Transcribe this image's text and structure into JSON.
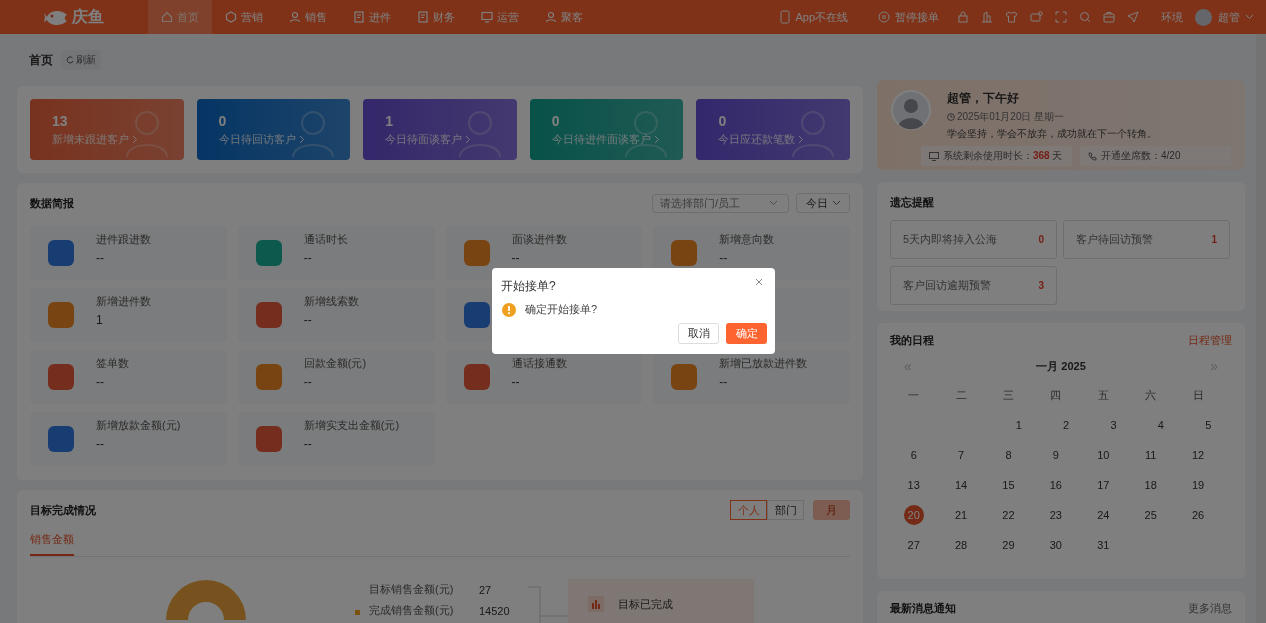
{
  "nav": {
    "logo": "庆鱼",
    "items": [
      {
        "label": "首页",
        "selected": true
      },
      {
        "label": "营销",
        "selected": false
      },
      {
        "label": "销售",
        "selected": false
      },
      {
        "label": "进件",
        "selected": false
      },
      {
        "label": "财务",
        "selected": false
      },
      {
        "label": "运营",
        "selected": false
      },
      {
        "label": "聚客",
        "selected": false
      }
    ],
    "app_status": "App不在线",
    "pause": "暂停接单",
    "env": "环境",
    "user": "超管"
  },
  "header": {
    "title": "首页",
    "refresh": "刷新"
  },
  "stat_cards": [
    {
      "value": "13",
      "label": "新增未跟进客户"
    },
    {
      "value": "0",
      "label": "今日待回访客户"
    },
    {
      "value": "1",
      "label": "今日待面谈客户"
    },
    {
      "value": "0",
      "label": "今日待进件面谈客户"
    },
    {
      "value": "0",
      "label": "今日应还款笔数"
    }
  ],
  "data_brief": {
    "title": "数据简报",
    "select": {
      "placeholder": "请选择部门/员工"
    },
    "period": "今日",
    "metrics": [
      {
        "kind": "shown",
        "label": "进件跟进数",
        "value": "--"
      },
      {
        "kind": "shown",
        "label": "通话时长",
        "value": "--"
      },
      {
        "kind": "shown",
        "label": "面谈进件数",
        "value": "--"
      },
      {
        "kind": "shown",
        "label": "新增意向数",
        "value": "--"
      },
      {
        "kind": "shown",
        "label": "新增进件数",
        "value": "1"
      },
      {
        "kind": "shown",
        "label": "新增线索数",
        "value": "--"
      },
      {
        "kind": "icon_only"
      },
      {
        "kind": "covered"
      },
      {
        "kind": "shown",
        "label": "签单数",
        "value": "--"
      },
      {
        "kind": "shown",
        "label": "回款金额(元)",
        "value": "--"
      },
      {
        "kind": "shown",
        "label": "通话接通数",
        "value": "--"
      },
      {
        "kind": "shown",
        "label": "新增已放款进件数",
        "value": "--"
      },
      {
        "kind": "shown",
        "label": "新增放款金额(元)",
        "value": "--"
      },
      {
        "kind": "shown",
        "label": "新增实支出金额(元)",
        "value": "--"
      }
    ]
  },
  "goals": {
    "title": "目标完成情况",
    "scopes": [
      {
        "label": "个人",
        "selected": true
      },
      {
        "label": "部门",
        "selected": false
      }
    ],
    "period": "月",
    "tab": "销售金额",
    "legend": [
      {
        "label": "目标销售金额(元)",
        "value": "27",
        "marker": false
      },
      {
        "label": "完成销售金额(元)",
        "value": "14520",
        "marker": true
      }
    ],
    "callout": "目标已完成"
  },
  "greeting": {
    "title": "超管，下午好",
    "date": "2025年01月20日 星期一",
    "motto": "学会坚持，学会不放弃，成功就在下一个转角。",
    "remaining": "系统剩余使用时长：**368** 天",
    "seats": "开通坐席数：4/20"
  },
  "memo": {
    "title": "遗忘提醒",
    "items": [
      {
        "label": "5天内即将掉入公海",
        "count": "0"
      },
      {
        "label": "客户待回访预警",
        "count": "1"
      },
      {
        "label": "客户回访逾期预警",
        "count": "3"
      }
    ]
  },
  "schedule": {
    "title": "我的日程",
    "manage": "日程管理",
    "prev": "«",
    "next": "»",
    "month": "一月 2025",
    "weekdays": [
      "一",
      "二",
      "三",
      "四",
      "五",
      "六",
      "日"
    ],
    "weeks": [
      {
        "days": [
          {
            "day": "1",
            "selected": false
          },
          {
            "day": "2",
            "selected": false
          },
          {
            "day": "3",
            "selected": false
          },
          {
            "day": "4",
            "selected": false
          },
          {
            "day": "5",
            "selected": false
          }
        ]
      },
      {
        "days": [
          {
            "day": "6",
            "selected": false
          },
          {
            "day": "7",
            "selected": false
          },
          {
            "day": "8",
            "selected": false
          },
          {
            "day": "9",
            "selected": false
          },
          {
            "day": "10",
            "selected": false
          },
          {
            "day": "11",
            "selected": false
          },
          {
            "day": "12",
            "selected": false
          }
        ]
      },
      {
        "days": [
          {
            "day": "13",
            "selected": false
          },
          {
            "day": "14",
            "selected": false
          },
          {
            "day": "15",
            "selected": false
          },
          {
            "day": "16",
            "selected": false
          },
          {
            "day": "17",
            "selected": false
          },
          {
            "day": "18",
            "selected": false
          },
          {
            "day": "19",
            "selected": false
          }
        ]
      },
      {
        "days": [
          {
            "day": "20",
            "selected": true
          },
          {
            "day": "21",
            "selected": false
          },
          {
            "day": "22",
            "selected": false
          },
          {
            "day": "23",
            "selected": false
          },
          {
            "day": "24",
            "selected": false
          },
          {
            "day": "25",
            "selected": false
          },
          {
            "day": "26",
            "selected": false
          }
        ]
      },
      {
        "days": [
          {
            "day": "27",
            "selected": false
          },
          {
            "day": "28",
            "selected": false
          },
          {
            "day": "29",
            "selected": false
          },
          {
            "day": "30",
            "selected": false
          },
          {
            "day": "31",
            "selected": false
          }
        ]
      }
    ]
  },
  "news": {
    "title": "最新消息通知",
    "more": "更多消息"
  },
  "modal": {
    "title": "开始接单?",
    "message": "确定开始接单?",
    "cancel": "取消",
    "confirm": "确定"
  }
}
